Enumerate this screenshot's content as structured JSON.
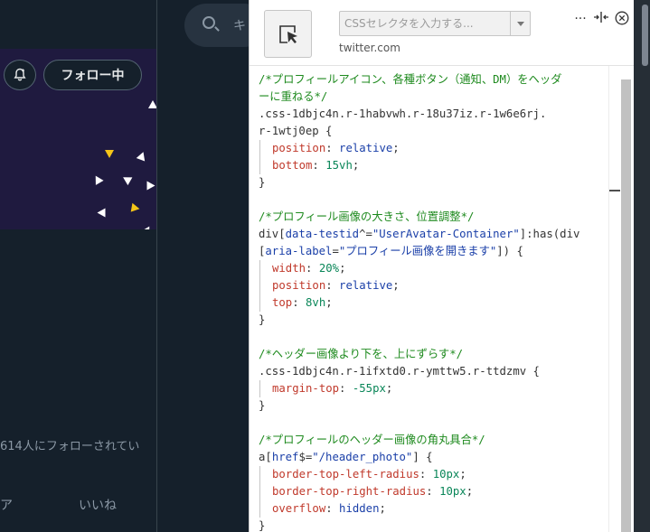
{
  "background_page": {
    "search_placeholder": "キ",
    "follow_button": "フォロー中",
    "followers_text": "614人にフォローされてい",
    "tab_partial": "ア",
    "tab_likes": "いいね"
  },
  "panel": {
    "selector_placeholder": "CSSセレクタを入力する...",
    "domain": "twitter.com",
    "icons": [
      "cursor-select-icon",
      "more-icon",
      "split-resize-icon",
      "close-icon"
    ]
  },
  "code_lines": [
    [
      [
        "cm",
        "/*プロフィールアイコン、各種ボタン（通知、DM）をヘッダ"
      ]
    ],
    [
      [
        "cm",
        "ーに重ねる*/"
      ]
    ],
    [
      [
        "sel",
        ".css-1dbjc4n.r-1habvwh.r-18u37iz.r-1w6e6rj."
      ]
    ],
    [
      [
        "sel",
        "r-1wtj0ep "
      ],
      [
        "pun",
        "{"
      ]
    ],
    [
      [
        "guide",
        ""
      ],
      [
        "prop",
        "position"
      ],
      [
        "pun",
        ": "
      ],
      [
        "val",
        "relative"
      ],
      [
        "pun",
        ";"
      ]
    ],
    [
      [
        "guide",
        ""
      ],
      [
        "prop",
        "bottom"
      ],
      [
        "pun",
        ": "
      ],
      [
        "num",
        "15vh"
      ],
      [
        "pun",
        ";"
      ]
    ],
    [
      [
        "pun",
        "}"
      ]
    ],
    [
      [
        "pun",
        ""
      ]
    ],
    [
      [
        "cm",
        "/*プロフィール画像の大きさ、位置調整*/"
      ]
    ],
    [
      [
        "sel",
        "div"
      ],
      [
        "pun",
        "["
      ],
      [
        "attr",
        "data-testid"
      ],
      [
        "pun",
        "^="
      ],
      [
        "str",
        "\"UserAvatar-Container\""
      ],
      [
        "pun",
        "]"
      ],
      [
        "sel",
        ":has(div"
      ]
    ],
    [
      [
        "pun",
        "["
      ],
      [
        "attr",
        "aria-label"
      ],
      [
        "pun",
        "="
      ],
      [
        "str",
        "\"プロフィール画像を開きます\""
      ],
      [
        "pun",
        "]) {"
      ]
    ],
    [
      [
        "guide",
        ""
      ],
      [
        "prop",
        "width"
      ],
      [
        "pun",
        ": "
      ],
      [
        "num",
        "20%"
      ],
      [
        "pun",
        ";"
      ]
    ],
    [
      [
        "guide",
        ""
      ],
      [
        "prop",
        "position"
      ],
      [
        "pun",
        ": "
      ],
      [
        "val",
        "relative"
      ],
      [
        "pun",
        ";"
      ]
    ],
    [
      [
        "guide",
        ""
      ],
      [
        "prop",
        "top"
      ],
      [
        "pun",
        ": "
      ],
      [
        "num",
        "8vh"
      ],
      [
        "pun",
        ";"
      ]
    ],
    [
      [
        "pun",
        "}"
      ]
    ],
    [
      [
        "pun",
        ""
      ]
    ],
    [
      [
        "cm",
        "/*ヘッダー画像より下を、上にずらす*/"
      ]
    ],
    [
      [
        "sel",
        ".css-1dbjc4n.r-1ifxtd0.r-ymttw5.r-ttdzmv "
      ],
      [
        "pun",
        "{"
      ]
    ],
    [
      [
        "guide",
        ""
      ],
      [
        "prop",
        "margin-top"
      ],
      [
        "pun",
        ": "
      ],
      [
        "num",
        "-55px"
      ],
      [
        "pun",
        ";"
      ]
    ],
    [
      [
        "pun",
        "}"
      ]
    ],
    [
      [
        "pun",
        ""
      ]
    ],
    [
      [
        "cm",
        "/*プロフィールのヘッダー画像の角丸具合*/"
      ]
    ],
    [
      [
        "sel",
        "a"
      ],
      [
        "pun",
        "["
      ],
      [
        "attr",
        "href"
      ],
      [
        "pun",
        "$="
      ],
      [
        "str",
        "\"/header_photo\""
      ],
      [
        "pun",
        "] {"
      ]
    ],
    [
      [
        "guide",
        ""
      ],
      [
        "prop",
        "border-top-left-radius"
      ],
      [
        "pun",
        ": "
      ],
      [
        "num",
        "10px"
      ],
      [
        "pun",
        ";"
      ]
    ],
    [
      [
        "guide",
        ""
      ],
      [
        "prop",
        "border-top-right-radius"
      ],
      [
        "pun",
        ": "
      ],
      [
        "num",
        "10px"
      ],
      [
        "pun",
        ";"
      ]
    ],
    [
      [
        "guide",
        ""
      ],
      [
        "prop",
        "overflow"
      ],
      [
        "pun",
        ": "
      ],
      [
        "val",
        "hidden"
      ],
      [
        "pun",
        ";"
      ]
    ],
    [
      [
        "pun",
        "}"
      ]
    ]
  ]
}
